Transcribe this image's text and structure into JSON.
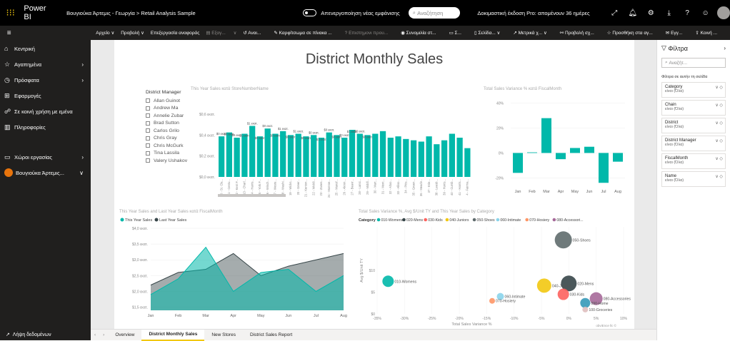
{
  "topbar": {
    "app": "Power BI",
    "breadcrumb": "Βουγιούκα Άρτεμις - Γεωργία > Retail Analysis Sample",
    "new_look": "Απενεργοποίηση νέας εμφάνισης",
    "search_placeholder": "Αναζήτηση",
    "trial": "Δοκιμαστική έκδοση Pro: απομένουν 36 ημέρες"
  },
  "cmdbar": {
    "file": "Αρχείο ∨",
    "view": "Προβολή ∨",
    "edit": "Επεξεργασία αναφοράς",
    "export": "Εξαγ...",
    "reset": "Αναι...",
    "pin": "Καρφίτσωμα σε πίνακα ...",
    "qna": "Επιστημονι πρου...",
    "subscribe": "Συνομιλία στ...",
    "comments": "Σ...",
    "pages": "Σελίδα... ∨",
    "metrics": "Μετρικά χ... ∨",
    "lineage": "Προβολή σχ...",
    "add": "Προσθήκη στα αγ...",
    "email": "Εγγ...",
    "share": "Κοινή ..."
  },
  "nav": {
    "home": "Κεντρική",
    "favorites": "Αγαπημένα",
    "recent": "Πρόσφατα",
    "apps": "Εφαρμογές",
    "shared": "Σε κοινή χρήση με εμένα",
    "learn": "Πληροφορίες",
    "workspaces": "Χώροι εργασίας",
    "my_workspace": "Βουγιούκα Άρτεμις...",
    "get_data": "Λήψη δεδομένων"
  },
  "report": {
    "title": "District Monthly Sales",
    "bar_title": "This Year Sales κατά StoreNumberName",
    "var_title": "Total Sales Variance % κατά FiscalMonth",
    "area_title": "This Year Sales and Last Year Sales κατά FiscalMonth",
    "area_legend": [
      "This Year Sales",
      "Last Year Sales"
    ],
    "scatter_title": "Total Sales Variance %, Avg $/Unit TY and This Year Sales by Category",
    "scatter_legend_label": "Category",
    "scatter_xlabel": "Total Sales Variance %",
    "scatter_ylabel": "Avg $/Unit TY",
    "scatter_footer": "obviEnce llc ©"
  },
  "slicer": {
    "title": "District Manager",
    "items": [
      "Allan Guinot",
      "Andrew Ma",
      "Annelie Zubar",
      "Brad Sutton",
      "Carlos Grilo",
      "Chris Gray",
      "Chris McGurk",
      "Tina Lassila",
      "Valery Ushakov"
    ]
  },
  "tabs": [
    "Overview",
    "District Monthly Sales",
    "New Stores",
    "District Sales Report"
  ],
  "filters": {
    "title": "Φίλτρα",
    "search": "Αναζήτ...",
    "section": "Φίλτρα σε αυτήν τη σελίδα",
    "cards": [
      {
        "name": "Category",
        "value": "είναι (Όλα)"
      },
      {
        "name": "Chain",
        "value": "είναι (Όλα)"
      },
      {
        "name": "District",
        "value": "είναι (Όλα)"
      },
      {
        "name": "District Manager",
        "value": "είναι (Όλα)"
      },
      {
        "name": "FiscalMonth",
        "value": "είναι (Όλα)"
      },
      {
        "name": "Name",
        "value": "είναι (Όλα)"
      }
    ]
  },
  "colors": {
    "teal": "#01b8aa",
    "dark": "#374649",
    "accent": "#f2c811"
  },
  "chart_data": [
    {
      "type": "bar",
      "title": "This Year Sales κατά StoreNumberName",
      "ylim": [
        0,
        1.2
      ],
      "yticks": [
        "$0,0 εκατ.",
        "$0,2 εκατ.",
        "$0,4 εκατ.",
        "$0,6 εκατ."
      ],
      "categories": [
        "10 - St. Cla...",
        "11 - Centu...",
        "12 - Kent F...",
        "13 - Charl...",
        "14 - Harris...",
        "15 - York F...",
        "16 - Winch...",
        "17 - Weste...",
        "18 - Washi...",
        "19 - Wicks...",
        "20 - Greer...",
        "21 - Kenton...",
        "22 - Wickli...",
        "23 - Zanes...",
        "24 - Monroe...",
        "25 - Mansf...",
        "26 - Akron...",
        "27 - Beavr...",
        "28 - Lansi...",
        "29 - Middl...",
        "30 - Mart...",
        "31 - Mont...",
        "32 - Altoo...",
        "33 - Alliso...",
        "34 - Pitts...",
        "35 - Green...",
        "36 - Meadv...",
        "37 - Erie...",
        "38 - Leesb...",
        "39 - Hunts...",
        "40 - Cumb...",
        "41 - Harris...",
        "4 - Fairma..."
      ],
      "values": [
        0.62,
        0.68,
        0.6,
        0.66,
        0.78,
        0.62,
        0.74,
        0.66,
        0.7,
        0.64,
        0.66,
        0.62,
        0.64,
        0.6,
        0.68,
        0.64,
        0.6,
        0.72,
        0.66,
        0.64,
        0.66,
        0.7,
        0.6,
        0.62,
        0.58,
        0.56,
        0.54,
        0.62,
        0.5,
        0.56,
        0.66,
        0.6,
        0.44
      ],
      "data_labels": [
        "$0 εκατ.",
        "$0 εκατ.",
        "$0 εκατ.",
        "$1 εκατ.",
        "$1 εκατ.",
        "$0 εκατ.",
        "$0 εκατ.",
        "$0 εκατ.",
        "$1 εκατ.",
        "$0 εκατ.",
        "$1 εκατ.",
        "$0 εκατ.",
        "$0 εκατ.",
        "$1 εκατ.",
        "$0 εκατ.",
        "$0 εκατ.",
        "$0 εκατ.",
        "$1 εκατ.",
        "$0 εκατ.",
        "$0 εκατ."
      ]
    },
    {
      "type": "bar",
      "title": "Total Sales Variance % κατά FiscalMonth",
      "categories": [
        "Jan",
        "Feb",
        "Mar",
        "Apr",
        "May",
        "Jun",
        "Jul",
        "Aug"
      ],
      "values": [
        -16,
        0.5,
        28,
        -5,
        4,
        5,
        -24,
        -7
      ],
      "ylim": [
        -25,
        45
      ],
      "yticks": [
        "-20%",
        "0%",
        "20%",
        "40%"
      ]
    },
    {
      "type": "area",
      "title": "This Year Sales and Last Year Sales κατά FiscalMonth",
      "categories": [
        "Jan",
        "Feb",
        "Mar",
        "Apr",
        "May",
        "Jun",
        "Jul",
        "Aug"
      ],
      "ylim": [
        1.4,
        4.0
      ],
      "yticks": [
        "$1,5 εκατ.",
        "$2,0 εκατ.",
        "$2,5 εκατ.",
        "$3,0 εκατ.",
        "$3,5 εκατ.",
        "$4,0 εκατ."
      ],
      "series": [
        {
          "name": "This Year Sales",
          "values": [
            1.9,
            2.4,
            3.4,
            2.0,
            2.6,
            2.7,
            2.0,
            2.5
          ]
        },
        {
          "name": "Last Year Sales",
          "values": [
            2.2,
            2.6,
            2.7,
            3.2,
            2.5,
            2.8,
            3.0,
            3.2
          ]
        }
      ]
    },
    {
      "type": "scatter",
      "title": "Total Sales Variance %, Avg $/Unit TY and This Year Sales by Category",
      "xlim": [
        -35,
        10
      ],
      "ylim": [
        0,
        20
      ],
      "xticks": [
        "-35%",
        "-30%",
        "-25%",
        "-20%",
        "-15%",
        "-10%",
        "-5%",
        "0%",
        "5%",
        "10%"
      ],
      "yticks": [
        "$0",
        "$5",
        "$10"
      ],
      "points": [
        {
          "label": "010-Womens",
          "x": -33,
          "y": 7.5,
          "size": 8,
          "color": "#01b8aa"
        },
        {
          "label": "020-Mens",
          "x": 0,
          "y": 7.0,
          "size": 11,
          "color": "#374649"
        },
        {
          "label": "030-Kids",
          "x": -1,
          "y": 4.5,
          "size": 8,
          "color": "#fd625e"
        },
        {
          "label": "040-Juniors",
          "x": -4.5,
          "y": 6.5,
          "size": 10,
          "color": "#f2c811"
        },
        {
          "label": "050-Shoes",
          "x": -1,
          "y": 17,
          "size": 12,
          "color": "#5f6b6d"
        },
        {
          "label": "060-Intimate",
          "x": -12.5,
          "y": 4.0,
          "size": 5,
          "color": "#8ad4eb"
        },
        {
          "label": "070-Hosiery",
          "x": -14,
          "y": 3.0,
          "size": 4,
          "color": "#fe9666"
        },
        {
          "label": "080-Accessories",
          "x": 5,
          "y": 3.5,
          "size": 9,
          "color": "#a66999"
        },
        {
          "label": "090-Home",
          "x": 3,
          "y": 2.5,
          "size": 7,
          "color": "#3599b8"
        },
        {
          "label": "100-Groceries",
          "x": 3,
          "y": 1.0,
          "size": 4,
          "color": "#dfbfbf"
        }
      ],
      "legend": [
        "010-Womens",
        "020-Mens",
        "030-Kids",
        "040-Juniors",
        "050-Shoes",
        "060-Intimate",
        "070-Hosiery",
        "080-Accessori..."
      ]
    }
  ]
}
